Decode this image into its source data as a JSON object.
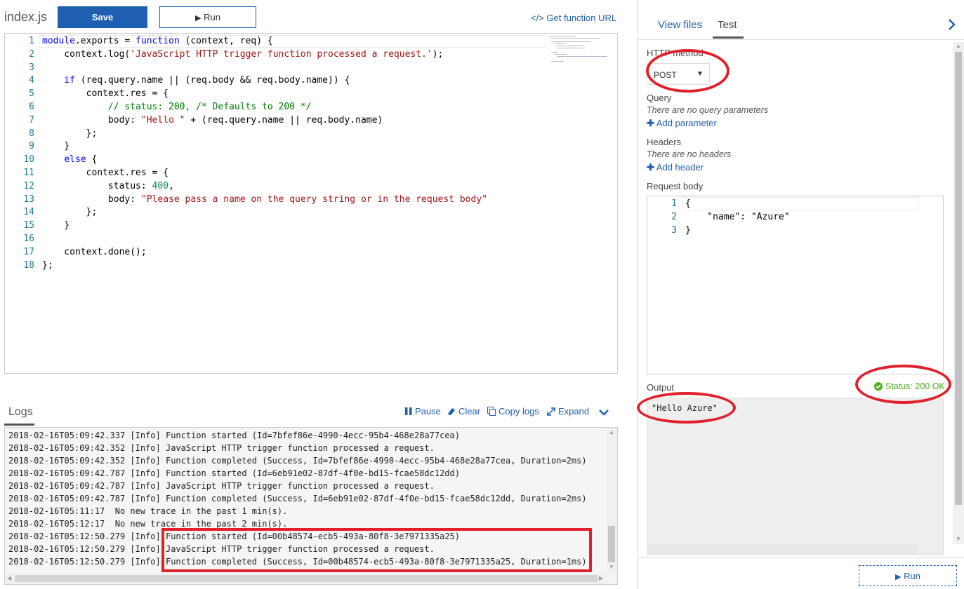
{
  "toolbar": {
    "file_title": "index.js",
    "save_label": "Save",
    "run_label": "Run",
    "get_url_label": "</> Get function URL"
  },
  "editor": {
    "lines": [
      {
        "n": "1",
        "parts": [
          {
            "c": "kw",
            "t": "module"
          },
          {
            "c": "",
            "t": ".exports = "
          },
          {
            "c": "kw",
            "t": "function"
          },
          {
            "c": "",
            "t": " (context, req) {"
          }
        ]
      },
      {
        "n": "2",
        "parts": [
          {
            "c": "",
            "t": "    context.log("
          },
          {
            "c": "str",
            "t": "'JavaScript HTTP trigger function processed a request.'"
          },
          {
            "c": "",
            "t": ");"
          }
        ]
      },
      {
        "n": "3",
        "parts": [
          {
            "c": "",
            "t": ""
          }
        ]
      },
      {
        "n": "4",
        "parts": [
          {
            "c": "",
            "t": "    "
          },
          {
            "c": "kw",
            "t": "if"
          },
          {
            "c": "",
            "t": " (req.query.name || (req.body && req.body.name)) {"
          }
        ]
      },
      {
        "n": "5",
        "parts": [
          {
            "c": "",
            "t": "        context.res = {"
          }
        ]
      },
      {
        "n": "6",
        "parts": [
          {
            "c": "cm",
            "t": "            // status: 200, /* Defaults to 200 */"
          }
        ]
      },
      {
        "n": "7",
        "parts": [
          {
            "c": "",
            "t": "            body: "
          },
          {
            "c": "str",
            "t": "\"Hello \""
          },
          {
            "c": "",
            "t": " + (req.query.name || req.body.name)"
          }
        ]
      },
      {
        "n": "8",
        "parts": [
          {
            "c": "",
            "t": "        };"
          }
        ]
      },
      {
        "n": "9",
        "parts": [
          {
            "c": "",
            "t": "    }"
          }
        ]
      },
      {
        "n": "10",
        "parts": [
          {
            "c": "",
            "t": "    "
          },
          {
            "c": "kw",
            "t": "else"
          },
          {
            "c": "",
            "t": " {"
          }
        ]
      },
      {
        "n": "11",
        "parts": [
          {
            "c": "",
            "t": "        context.res = {"
          }
        ]
      },
      {
        "n": "12",
        "parts": [
          {
            "c": "",
            "t": "            status: "
          },
          {
            "c": "num",
            "t": "400"
          },
          {
            "c": "",
            "t": ","
          }
        ]
      },
      {
        "n": "13",
        "parts": [
          {
            "c": "",
            "t": "            body: "
          },
          {
            "c": "str",
            "t": "\"Please pass a name on the query string or in the request body\""
          }
        ]
      },
      {
        "n": "14",
        "parts": [
          {
            "c": "",
            "t": "        };"
          }
        ]
      },
      {
        "n": "15",
        "parts": [
          {
            "c": "",
            "t": "    }"
          }
        ]
      },
      {
        "n": "16",
        "parts": [
          {
            "c": "",
            "t": ""
          }
        ]
      },
      {
        "n": "17",
        "parts": [
          {
            "c": "",
            "t": "    context.done();"
          }
        ]
      },
      {
        "n": "18",
        "parts": [
          {
            "c": "",
            "t": "};"
          }
        ]
      }
    ]
  },
  "logs": {
    "tab_label": "Logs",
    "pause_label": "Pause",
    "clear_label": "Clear",
    "copy_label": "Copy logs",
    "expand_label": "Expand",
    "lines": [
      "2018-02-16T05:09:42.337 [Info] Function started (Id=7bfef86e-4990-4ecc-95b4-468e28a77cea)",
      "2018-02-16T05:09:42.352 [Info] JavaScript HTTP trigger function processed a request.",
      "2018-02-16T05:09:42.352 [Info] Function completed (Success, Id=7bfef86e-4990-4ecc-95b4-468e28a77cea, Duration=2ms)",
      "2018-02-16T05:09:42.787 [Info] Function started (Id=6eb91e02-87df-4f0e-bd15-fcae58dc12dd)",
      "2018-02-16T05:09:42.787 [Info] JavaScript HTTP trigger function processed a request.",
      "2018-02-16T05:09:42.787 [Info] Function completed (Success, Id=6eb91e02-87df-4f0e-bd15-fcae58dc12dd, Duration=2ms)",
      "2018-02-16T05:11:17  No new trace in the past 1 min(s).",
      "2018-02-16T05:12:17  No new trace in the past 2 min(s).",
      "2018-02-16T05:12:50.279 [Info] Function started (Id=00b48574-ecb5-493a-80f8-3e7971335a25)",
      "2018-02-16T05:12:50.279 [Info] JavaScript HTTP trigger function processed a request.",
      "2018-02-16T05:12:50.279 [Info] Function completed (Success, Id=00b48574-ecb5-493a-80f8-3e7971335a25, Duration=1ms)"
    ]
  },
  "right_panel": {
    "tabs": [
      {
        "label": "View files"
      },
      {
        "label": "Test"
      }
    ],
    "http_method_label": "HTTP method",
    "http_method_value": "POST",
    "query_label": "Query",
    "query_empty": "There are no query parameters",
    "add_parameter": "Add parameter",
    "headers_label": "Headers",
    "headers_empty": "There are no headers",
    "add_header": "Add header",
    "request_body_label": "Request body",
    "request_body_lines": [
      {
        "n": "1",
        "t": "{"
      },
      {
        "n": "2",
        "t": "    \"name\": \"Azure\""
      },
      {
        "n": "3",
        "t": "}"
      }
    ],
    "output_label": "Output",
    "status_text": "Status: 200 OK",
    "output_text": "\"Hello Azure\"",
    "run_label": "Run"
  },
  "colors": {
    "accent": "#1f5fb1",
    "success": "#4caf1e",
    "annotation": "#e0202a"
  }
}
